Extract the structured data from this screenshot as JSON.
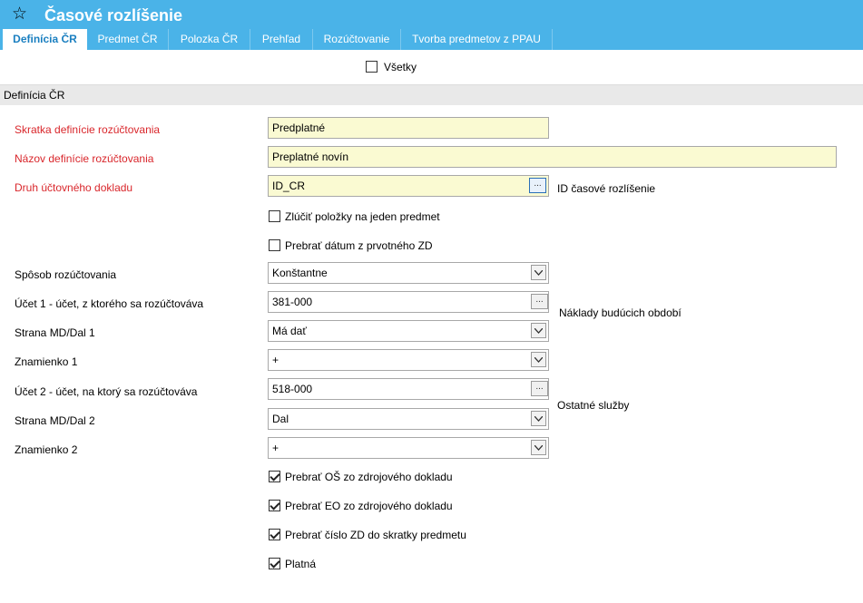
{
  "app": {
    "title": "Časové rozlíšenie",
    "star_icon": "star-icon"
  },
  "tabs": [
    {
      "label": "Definícia ČR",
      "active": true
    },
    {
      "label": "Predmet ČR",
      "active": false
    },
    {
      "label": "Polozka ČR",
      "active": false
    },
    {
      "label": "Prehľad",
      "active": false
    },
    {
      "label": "Rozúčtovanie",
      "active": false
    },
    {
      "label": "Tvorba predmetov z PPAU",
      "active": false
    }
  ],
  "filter": {
    "all_label": "Všetky",
    "all_checked": false
  },
  "section": {
    "title": "Definícia ČR"
  },
  "form": {
    "skratka": {
      "label": "Skratka definície rozúčtovania",
      "value": "Predplatné"
    },
    "nazov": {
      "label": "Názov definície rozúčtovania",
      "value": "Preplatné novín"
    },
    "druh": {
      "label": "Druh účtovného dokladu",
      "value": "ID_CR",
      "side": "ID časové rozlíšenie",
      "button": "..."
    },
    "zlucit": {
      "label": "Zlúčiť položky na jeden predmet",
      "checked": false
    },
    "prebrat_datum": {
      "label": "Prebrať dátum z prvotného ZD",
      "checked": false
    },
    "sposob": {
      "label": "Spôsob rozúčtovania",
      "value": "Konštantne"
    },
    "ucet1": {
      "label": "Účet 1 - účet, z ktorého sa rozúčtováva",
      "value": "381-000",
      "side": "Náklady budúcich období",
      "button": "..."
    },
    "strana1": {
      "label": "Strana MD/Dal 1",
      "value": "Má dať"
    },
    "znamienko1": {
      "label": "Znamienko 1",
      "value": "+"
    },
    "ucet2": {
      "label": "Účet 2 - účet, na ktorý sa rozúčtováva",
      "value": "518-000",
      "side": "Ostatné služby",
      "button": "..."
    },
    "strana2": {
      "label": "Strana MD/Dal 2",
      "value": "Dal"
    },
    "znamienko2": {
      "label": "Znamienko 2",
      "value": "+"
    },
    "prebrat_os": {
      "label": "Prebrať OŠ zo zdrojového dokladu",
      "checked": true
    },
    "prebrat_eo": {
      "label": "Prebrať EO zo zdrojového dokladu",
      "checked": true
    },
    "prebrat_cislo": {
      "label": "Prebrať číslo ZD do skratky predmetu",
      "checked": true
    },
    "platna": {
      "label": "Platná",
      "checked": true
    }
  },
  "colors": {
    "accent": "#4ab3e8",
    "required_label": "#d9262b",
    "required_field": "#fafad2"
  }
}
